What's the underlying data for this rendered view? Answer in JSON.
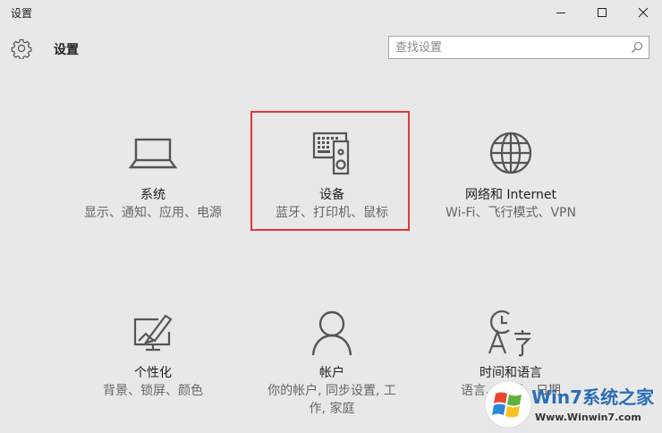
{
  "window": {
    "title": "设置",
    "controls": [
      "minimize-icon",
      "maximize-icon",
      "close-icon"
    ]
  },
  "header": {
    "title": "设置",
    "icon": "gear-icon"
  },
  "search": {
    "placeholder": "查找设置",
    "value": "",
    "icon": "search-icon"
  },
  "tiles": [
    {
      "title": "系统",
      "desc": "显示、通知、应用、电源",
      "icon": "laptop-icon"
    },
    {
      "title": "设备",
      "desc": "蓝牙、打印机、鼠标",
      "icon": "devices-icon"
    },
    {
      "title": "网络和 Internet",
      "desc": "Wi-Fi、飞行模式、VPN",
      "icon": "globe-icon"
    },
    {
      "title": "个性化",
      "desc": "背景、锁屏、颜色",
      "icon": "personalization-icon"
    },
    {
      "title": "帐户",
      "desc": "你的帐户, 同步设置, 工作, 家庭",
      "icon": "account-icon"
    },
    {
      "title": "时间和语言",
      "desc": "语言、区域、日期",
      "icon": "time-language-icon"
    }
  ],
  "highlight_color": "#e53535",
  "watermark": {
    "brand": "Win7系统之家",
    "url": "Www.Winwin7.com"
  }
}
